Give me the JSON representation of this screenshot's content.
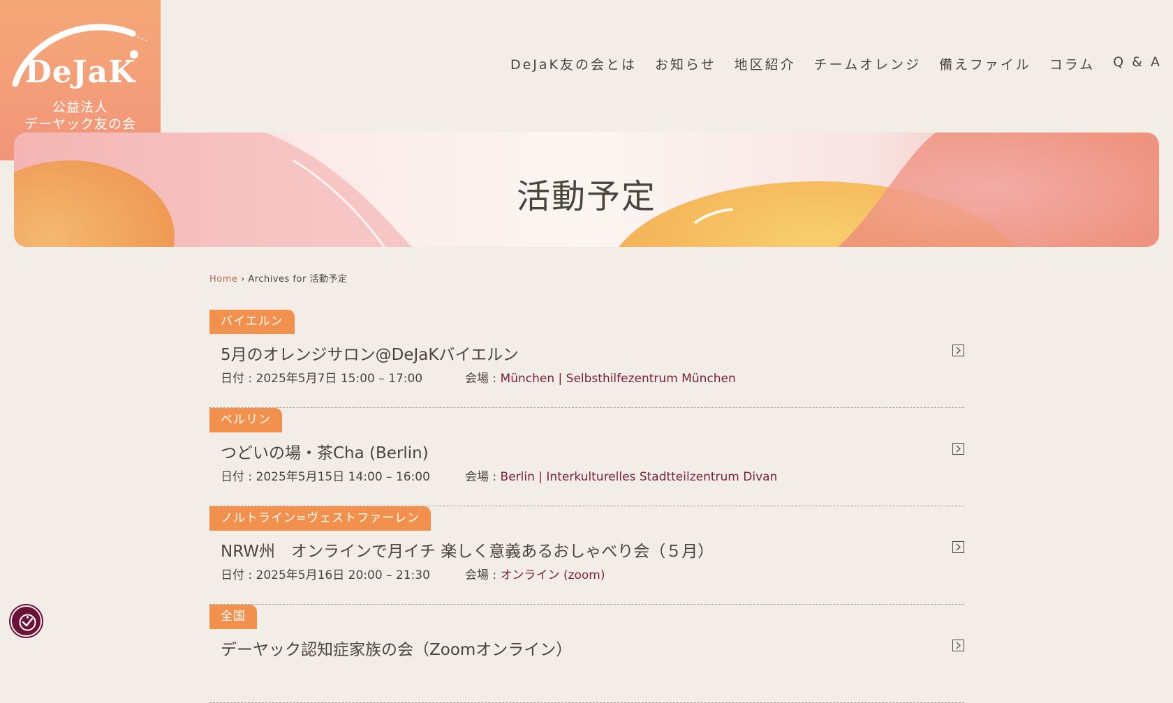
{
  "logo": {
    "wordmark": "DeJaK",
    "org_line1": "公益法人",
    "org_line2": "デーヤック友の会"
  },
  "nav": {
    "items": [
      {
        "label": "DeJaK友の会とは"
      },
      {
        "label": "お知らせ"
      },
      {
        "label": "地区紹介"
      },
      {
        "label": "チームオレンジ"
      },
      {
        "label": "備えファイル"
      },
      {
        "label": "コラム"
      },
      {
        "label": "Q & A"
      }
    ]
  },
  "hero": {
    "title": "活動予定"
  },
  "breadcrumb": {
    "home": "Home",
    "separator": "›",
    "current": "Archives for 活動予定"
  },
  "events": [
    {
      "tag": "バイエルン",
      "title": "5月のオレンジサロン@DeJaKバイエルン",
      "date": "日付 : 2025年5月7日 15:00 – 17:00",
      "venue_label": "会場 : ",
      "venue": "München | Selbsthilfezentrum München"
    },
    {
      "tag": "ベルリン",
      "title": "つどいの場・茶Cha (Berlin)",
      "date": "日付 : 2025年5月15日 14:00 – 16:00",
      "venue_label": "会場 : ",
      "venue": "Berlin | Interkulturelles Stadtteilzentrum Divan"
    },
    {
      "tag": "ノルトライン=ヴェストファーレン",
      "title": "NRW州　オンラインで月イチ 楽しく意義あるおしゃべり会（５月）",
      "date": "日付 : 2025年5月16日 20:00 – 21:30",
      "venue_label": "会場 : ",
      "venue": "オンライン (zoom)"
    },
    {
      "tag": "全国",
      "title": "デーヤック認知症家族の会（Zoomオンライン）",
      "date": "",
      "venue_label": "",
      "venue": ""
    }
  ],
  "colors": {
    "background": "#f2ede7",
    "tag": "#f2914e",
    "venue_link": "#7a1f3d",
    "logo_bg": "#f5a877"
  }
}
